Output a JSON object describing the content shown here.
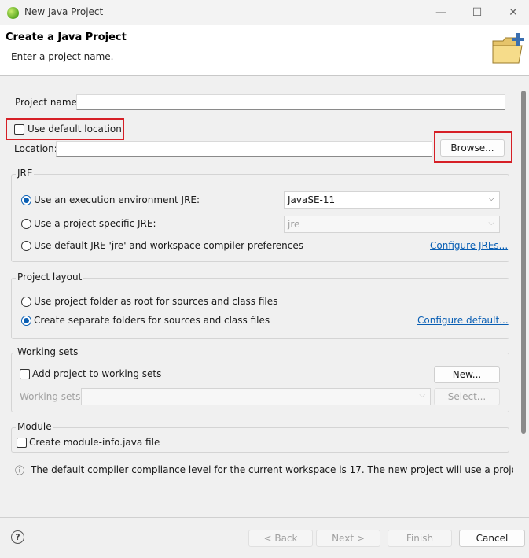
{
  "window": {
    "title": "New Java Project",
    "minimize": "—",
    "maximize": "☐",
    "close": "✕"
  },
  "header": {
    "title": "Create a Java Project",
    "description": "Enter a project name."
  },
  "project": {
    "name_label": "Project name:",
    "name_value": "",
    "use_default_location_label": "Use default location",
    "use_default_location_checked": false,
    "location_label": "Location:",
    "location_value": "",
    "browse_label": "Browse..."
  },
  "jre": {
    "title": "JRE",
    "option_env_label": "Use an execution environment JRE:",
    "option_env_value": "JavaSE-11",
    "option_specific_label": "Use a project specific JRE:",
    "option_specific_value": "jre",
    "option_default_label": "Use default JRE 'jre' and workspace compiler preferences",
    "configure_link": "Configure JREs..."
  },
  "layout": {
    "title": "Project layout",
    "option_root_label": "Use project folder as root for sources and class files",
    "option_separate_label": "Create separate folders for sources and class files",
    "configure_link": "Configure default..."
  },
  "working_sets": {
    "title": "Working sets",
    "add_label": "Add project to working sets",
    "new_label": "New...",
    "sets_label": "Working sets:",
    "select_label": "Select..."
  },
  "module": {
    "title": "Module",
    "create_label": "Create module-info.java file"
  },
  "info": {
    "icon": "ⓘ",
    "message": "The default compiler compliance level for the current workspace is 17. The new project will use a project"
  },
  "footer": {
    "help": "?",
    "back_label": "< Back",
    "next_label": "Next >",
    "finish_label": "Finish",
    "cancel_label": "Cancel"
  },
  "colors": {
    "accent": "#0a5fb4",
    "highlight": "#d61f26"
  }
}
